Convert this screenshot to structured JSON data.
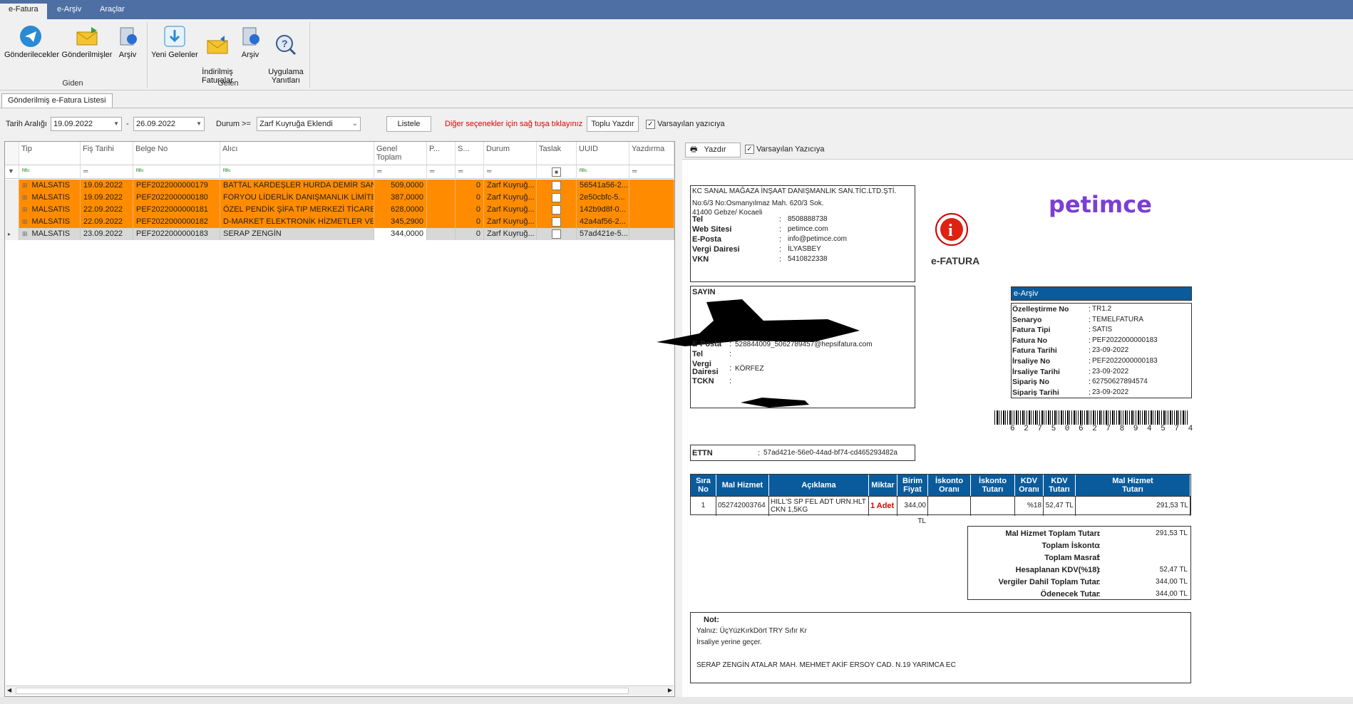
{
  "ribbon": {
    "tabs": [
      "e-Fatura",
      "e-Arşiv",
      "Araçlar"
    ],
    "giden_buttons": [
      "Gönderilecekler",
      "Gönderilmişler",
      "Arşiv"
    ],
    "giden_label": "Giden",
    "gelen_buttons": [
      "Yeni Gelenler",
      "İndirilmiş\nFaturalar",
      "Arşiv",
      "Uygulama\nYanıtları"
    ],
    "gelen_label": "Gelen"
  },
  "doc_tab": "Gönderilmiş e-Fatura Listesi",
  "filter": {
    "date_label": "Tarih Aralığı",
    "date_from": "19.09.2022",
    "date_sep": "-",
    "date_to": "26.09.2022",
    "status_label": "Durum >=",
    "status_value": "Zarf Kuyruğa Eklendi",
    "list_button": "Listele",
    "hint": "Diğer seçenekler için sağ tuşa tıklayınız",
    "bulk_print_button": "Toplu Yazdır",
    "default_printer_label": "Varsayılan yazıcıya"
  },
  "grid": {
    "columns": [
      "Tip",
      "Fiş Tarihi",
      "Belge No",
      "Alıcı",
      "Genel\nToplam",
      "P...",
      "S...",
      "Durum",
      "Taslak",
      "UUID",
      "Yazdırma"
    ],
    "rows": [
      {
        "tip": "MALSATIS",
        "date": "19.09.2022",
        "no": "PEF2022000000179",
        "alici": "BATTAL KARDEŞLER HURDA DEMİR SAN...",
        "toplam": "509,0000",
        "s": "0",
        "durum": "Zarf Kuyruğ...",
        "uuid": "56541a56-2...",
        "style": "orange"
      },
      {
        "tip": "MALSATIS",
        "date": "19.09.2022",
        "no": "PEF2022000000180",
        "alici": "FORYOU LİDERLİK DANIŞMANLIK LİMİTE...",
        "toplam": "387,0000",
        "s": "0",
        "durum": "Zarf Kuyruğ...",
        "uuid": "2e50cbfc-5...",
        "style": "orange"
      },
      {
        "tip": "MALSATIS",
        "date": "22.09.2022",
        "no": "PEF2022000000181",
        "alici": "ÖZEL PENDİK ŞİFA TIP MERKEZİ TİCARE...",
        "toplam": "628,0000",
        "s": "0",
        "durum": "Zarf Kuyruğ...",
        "uuid": "142b9d8f-0...",
        "style": "orange"
      },
      {
        "tip": "MALSATIS",
        "date": "22.09.2022",
        "no": "PEF2022000000182",
        "alici": "D-MARKET ELEKTRONİK HİZMETLER VE T...",
        "toplam": "345,2900",
        "s": "0",
        "durum": "Zarf Kuyruğ...",
        "uuid": "42a4af56-2...",
        "style": "orange"
      },
      {
        "tip": "MALSATIS",
        "date": "23.09.2022",
        "no": "PEF2022000000183",
        "alici": "SERAP ZENGİN",
        "toplam": "344,0000",
        "s": "0",
        "durum": "Zarf Kuyruğ...",
        "uuid": "57ad421e-5...",
        "style": "gray"
      }
    ]
  },
  "preview": {
    "print_button": "Yazdır",
    "default_printer_label": "Varsayılan Yazıcıya",
    "seller": {
      "name": "KC SANAL MAĞAZA İNŞAAT DANIŞMANLIK SAN.TİC.LTD.ŞTİ.",
      "addr1": "No:6/3  No:Osmanyılmaz Mah. 620/3 Sok.",
      "addr2": "41400 Gebze/ Kocaeli",
      "fields": [
        [
          "Tel",
          "8508888738"
        ],
        [
          "Web Sitesi",
          "petimce.com"
        ],
        [
          "E-Posta",
          "info@petimce.com"
        ],
        [
          "Vergi Dairesi",
          "İLYASBEY"
        ],
        [
          "VKN",
          "5410822338"
        ]
      ]
    },
    "logo_text": "petimce",
    "efatura_label": "e-FATURA",
    "buyer": {
      "title": "SAYIN",
      "fields": [
        [
          "E-Posta",
          "528844009_5062789457@hepsifatura.com"
        ],
        [
          "Tel",
          ""
        ],
        [
          "Vergi\nDairesi",
          "KÖRFEZ"
        ],
        [
          "TCKN",
          ""
        ]
      ]
    },
    "earsiv": {
      "title": "e-Arşiv",
      "fields": [
        [
          "Özelleştirme No",
          "TR1.2"
        ],
        [
          "Senaryo",
          "TEMELFATURA"
        ],
        [
          "Fatura Tipi",
          "SATIS"
        ],
        [
          "Fatura No",
          "PEF2022000000183"
        ],
        [
          "Fatura Tarihi",
          "23-09-2022"
        ],
        [
          "İrsaliye No",
          "PEF2022000000183"
        ],
        [
          "İrsaliye Tarihi",
          "23-09-2022"
        ],
        [
          "Sipariş No",
          "62750627894574"
        ],
        [
          "Sipariş Tarihi",
          "23-09-2022"
        ]
      ]
    },
    "barcode_digits": "6 2 7 5 0 6 2 7 8 9 4 5 7 4",
    "ettn_label": "ETTN",
    "ettn_value": "57ad421e-56e0-44ad-bf74-cd465293482a",
    "items_header": [
      "Sıra\nNo",
      "Mal Hizmet",
      "Açıklama",
      "Miktar",
      "Birim\nFiyat",
      "İskonto\nOranı",
      "İskonto\nTutarı",
      "KDV\nOranı",
      "KDV\nTutarı",
      "Mal Hizmet\nTutarı"
    ],
    "item": [
      "1",
      "052742003764",
      "HILL'S SP FEL ADT URN.HLT CKN 1,5KG",
      "1 Adet",
      "344,00 TL",
      "",
      "",
      "%18",
      "52,47 TL",
      "291,53 TL"
    ],
    "totals": [
      [
        "Mal Hizmet Toplam Tutarı",
        "291,53 TL"
      ],
      [
        "Toplam İskonto",
        ""
      ],
      [
        "Toplam Masraf",
        ""
      ],
      [
        "Hesaplanan KDV(%18)",
        "52,47 TL"
      ],
      [
        "Vergiler Dahil Toplam Tutar",
        "344,00 TL"
      ],
      [
        "Ödenecek Tutar",
        "344,00 TL"
      ]
    ],
    "note_title": "Not:",
    "note_lines": [
      "Yalnız: ÜçYüzKırkDört TRY Sıfır Kr",
      "İrsaliye yerine geçer.",
      "",
      "SERAP ZENGİN ATALAR MAH. MEHMET AKİF ERSOY CAD. N.19 YARIMCA EC"
    ]
  },
  "colors": {
    "ribbon": "#4d6fa3",
    "row_orange": "#ff8c00",
    "table_header": "#0a5b9c",
    "hint": "#e00000"
  }
}
